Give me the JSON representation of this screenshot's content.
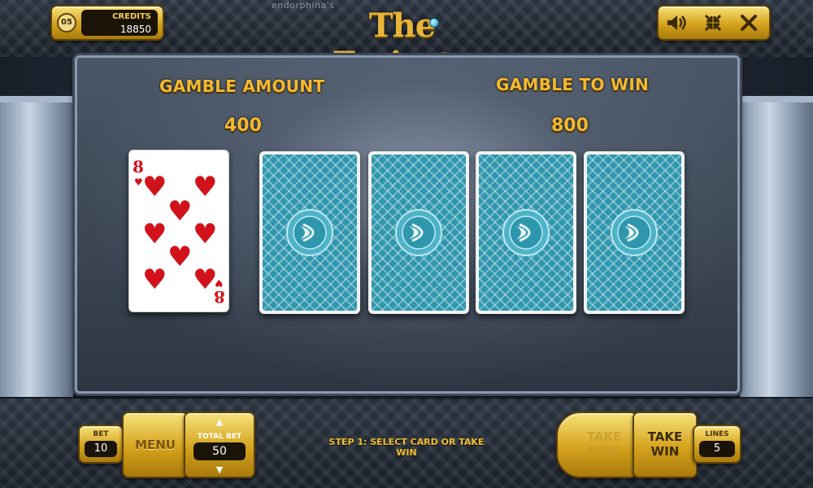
{
  "header": {
    "level": "05",
    "credits_label": "CREDITS",
    "credits_value": "18850",
    "brand": "endorphina's",
    "title": "The Emirate",
    "sound_icon": "speaker-icon",
    "fullscreen_icon": "fullscreen-icon",
    "close_icon": "close-icon"
  },
  "gamble": {
    "amount_label": "GAMBLE AMOUNT",
    "amount_value": "400",
    "to_win_label": "GAMBLE TO WIN",
    "to_win_value": "800",
    "dealer_card": {
      "rank": "8",
      "suit": "♥",
      "suit_name": "hearts",
      "color": "#d1121a"
    },
    "face_down_cards": 4,
    "card_back_color": "#2f97ad"
  },
  "footer": {
    "bet_label": "BET",
    "bet_value": "10",
    "menu_label": "MENU",
    "total_bet_label": "TOTAL BET",
    "total_bet_value": "50",
    "step_text": "STEP 1: SELECT CARD OR TAKE WIN",
    "take_risk_line1": "TAKE",
    "take_risk_line2": "RISK",
    "take_win_line1": "TAKE",
    "take_win_line2": "WIN",
    "lines_label": "LINES",
    "lines_value": "5"
  },
  "colors": {
    "gold": "#f3b92e",
    "accent_red": "#d1121a"
  }
}
